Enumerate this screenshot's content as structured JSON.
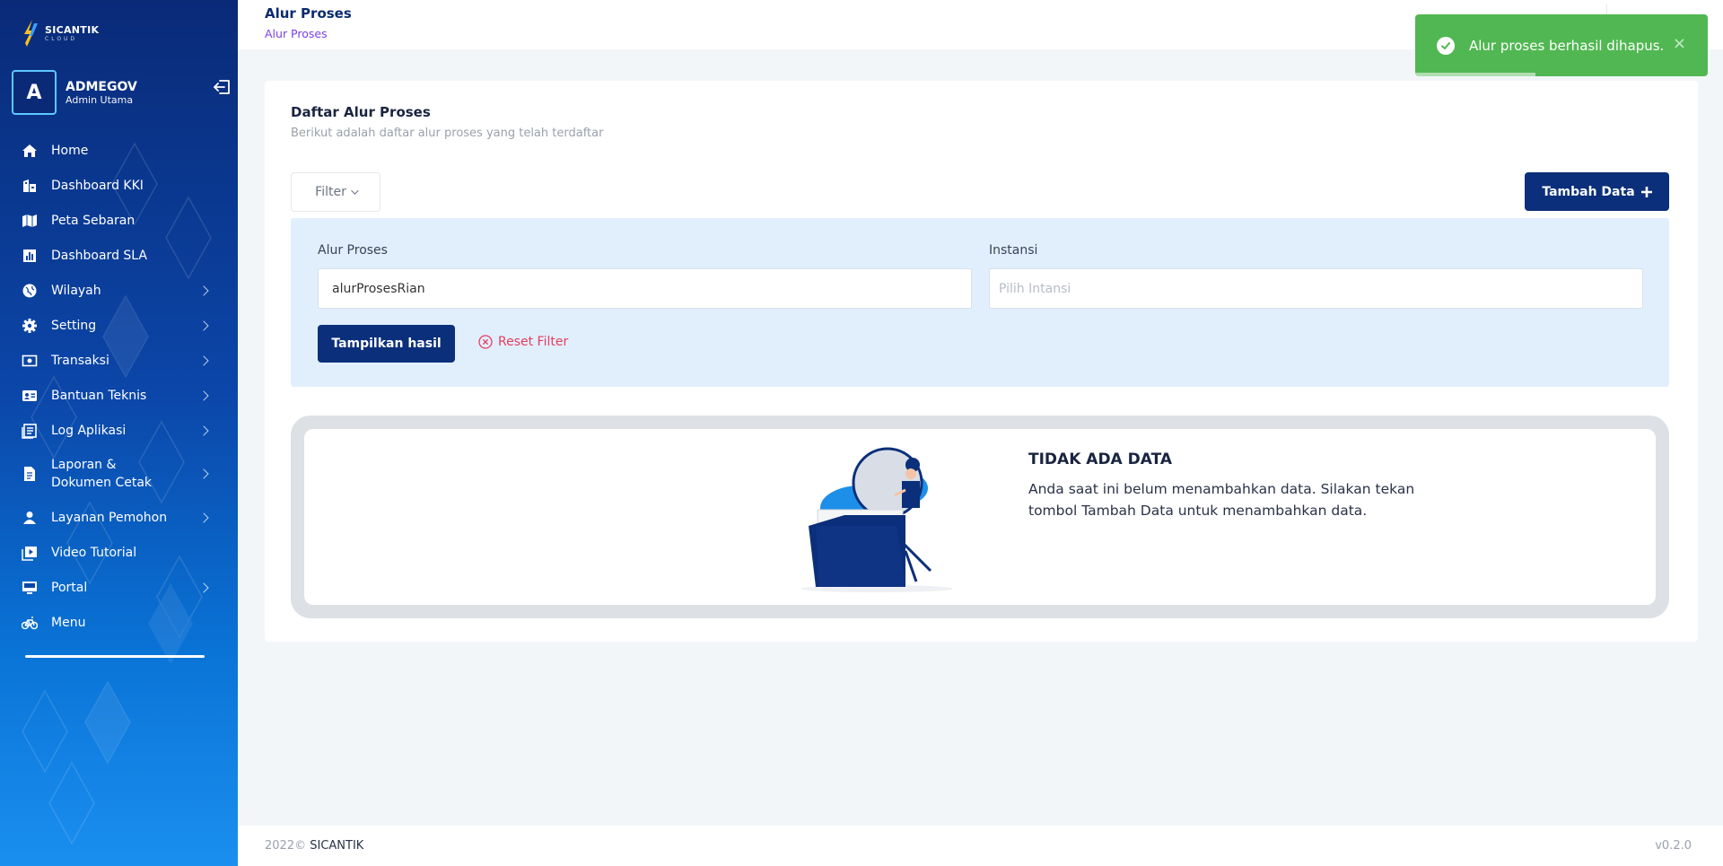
{
  "app": {
    "logo_name": "SICANTIK",
    "logo_sub": "CLOUD"
  },
  "user": {
    "initial": "A",
    "name": "ADMEGOV",
    "role": "Admin Utama"
  },
  "sidebar": {
    "items": [
      {
        "label": "Home",
        "icon": "home-icon",
        "has_submenu": false
      },
      {
        "label": "Dashboard KKI",
        "icon": "building-icon",
        "has_submenu": false
      },
      {
        "label": "Peta Sebaran",
        "icon": "map-icon",
        "has_submenu": false
      },
      {
        "label": "Dashboard SLA",
        "icon": "bar-chart-icon",
        "has_submenu": false
      },
      {
        "label": "Wilayah",
        "icon": "globe-icon",
        "has_submenu": true
      },
      {
        "label": "Setting",
        "icon": "gear-icon",
        "has_submenu": true
      },
      {
        "label": "Transaksi",
        "icon": "money-icon",
        "has_submenu": true
      },
      {
        "label": "Bantuan Teknis",
        "icon": "id-card-icon",
        "has_submenu": true
      },
      {
        "label": "Log Aplikasi",
        "icon": "log-icon",
        "has_submenu": true
      },
      {
        "label": "Laporan & Dokumen Cetak",
        "icon": "document-icon",
        "has_submenu": true
      },
      {
        "label": "Layanan Pemohon",
        "icon": "user-icon",
        "has_submenu": true
      },
      {
        "label": "Video Tutorial",
        "icon": "video-icon",
        "has_submenu": false
      },
      {
        "label": "Portal",
        "icon": "monitor-icon",
        "has_submenu": true
      },
      {
        "label": "Menu",
        "icon": "bicycle-icon",
        "has_submenu": false
      }
    ]
  },
  "header": {
    "title": "Alur Proses",
    "breadcrumb": "Alur Proses"
  },
  "main": {
    "title": "Daftar Alur Proses",
    "subtitle": "Berikut adalah daftar alur proses yang telah terdaftar",
    "filter_label": "Filter",
    "add_label": "Tambah Data",
    "filter": {
      "alur_label": "Alur Proses",
      "alur_value": "alurProsesRian",
      "instansi_label": "Instansi",
      "instansi_placeholder": "Pilih Intansi",
      "show_label": "Tampilkan hasil",
      "reset_label": "Reset Filter"
    },
    "empty": {
      "title": "TIDAK ADA DATA",
      "description": "Anda saat ini belum menambahkan data. Silakan tekan tombol Tambah Data untuk menambahkan data."
    }
  },
  "footer": {
    "year": "2022©",
    "brand": "SICANTIK",
    "version": "v0.2.0"
  },
  "toast": {
    "message": "Alur proses berhasil dihapus.",
    "close": "×",
    "progress_fraction": 0.41
  },
  "colors": {
    "primary": "#0b2f7a",
    "success": "#51b752",
    "danger": "#e53d5f",
    "breadcrumb": "#7b3fe4"
  }
}
